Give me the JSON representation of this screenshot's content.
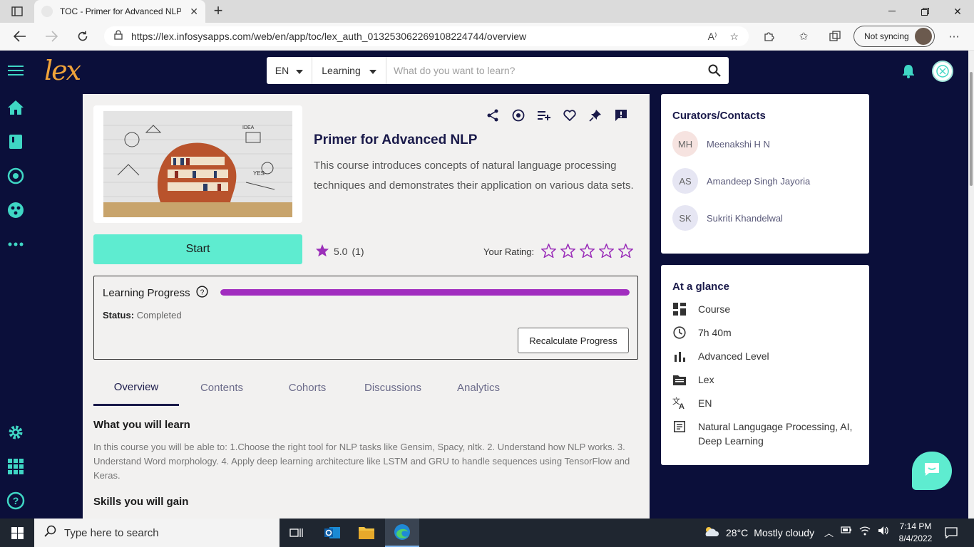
{
  "browser": {
    "tab_title": "TOC - Primer for Advanced NLP",
    "url": "https://lex.infosysapps.com/web/en/app/toc/lex_auth_013253062269108224744/overview",
    "profile_label": "Not syncing"
  },
  "header": {
    "logo_text": "lex",
    "language": "EN",
    "category": "Learning",
    "search_placeholder": "What do you want to learn?"
  },
  "course": {
    "title": "Primer for Advanced NLP",
    "description": "This course introduces concepts of natural language processing techniques and demonstrates their application on various data sets.",
    "start_label": "Start",
    "rating_value": "5.0",
    "rating_count": "(1)",
    "your_rating_label": "Your Rating:"
  },
  "progress": {
    "title": "Learning Progress",
    "percent": 100,
    "status_label": "Status:",
    "status_value": "Completed",
    "recalc_label": "Recalculate Progress"
  },
  "tabs": [
    "Overview",
    "Contents",
    "Cohorts",
    "Discussions",
    "Analytics"
  ],
  "overview": {
    "what_title": "What you will learn",
    "what_text": "In this course you will be able to: 1.Choose the right tool for NLP tasks like Gensim, Spacy, nltk. 2. Understand how NLP works. 3. Understand Word morphology. 4. Apply deep learning architecture like LSTM and GRU to handle sequences using TensorFlow and Keras.",
    "skills_title": "Skills you will gain"
  },
  "curators": {
    "title": "Curators/Contacts",
    "people": [
      {
        "initials": "MH",
        "name": "Meenakshi H N",
        "color": "#f6e3e0"
      },
      {
        "initials": "AS",
        "name": "Amandeep Singh Jayoria",
        "color": "#e6e6f3"
      },
      {
        "initials": "SK",
        "name": "Sukriti Khandelwal",
        "color": "#e6e6f3"
      }
    ]
  },
  "glance": {
    "title": "At a glance",
    "items": [
      {
        "icon": "dashboard-icon",
        "text": "Course"
      },
      {
        "icon": "clock-icon",
        "text": "7h 40m"
      },
      {
        "icon": "bar-chart-icon",
        "text": "Advanced Level"
      },
      {
        "icon": "folder-icon",
        "text": "Lex"
      },
      {
        "icon": "translate-icon",
        "text": "EN"
      },
      {
        "icon": "subject-icon",
        "text": "Natural Langugage Processing, AI, Deep Learning"
      }
    ]
  },
  "taskbar": {
    "search_placeholder": "Type here to search",
    "weather_temp": "28°C",
    "weather_text": "Mostly cloudy",
    "time": "7:14 PM",
    "date": "8/4/2022"
  },
  "colors": {
    "accent": "#5eecd0",
    "progress": "#a12dbf",
    "navy": "#0b0f3a",
    "star": "#9b2fb9"
  }
}
